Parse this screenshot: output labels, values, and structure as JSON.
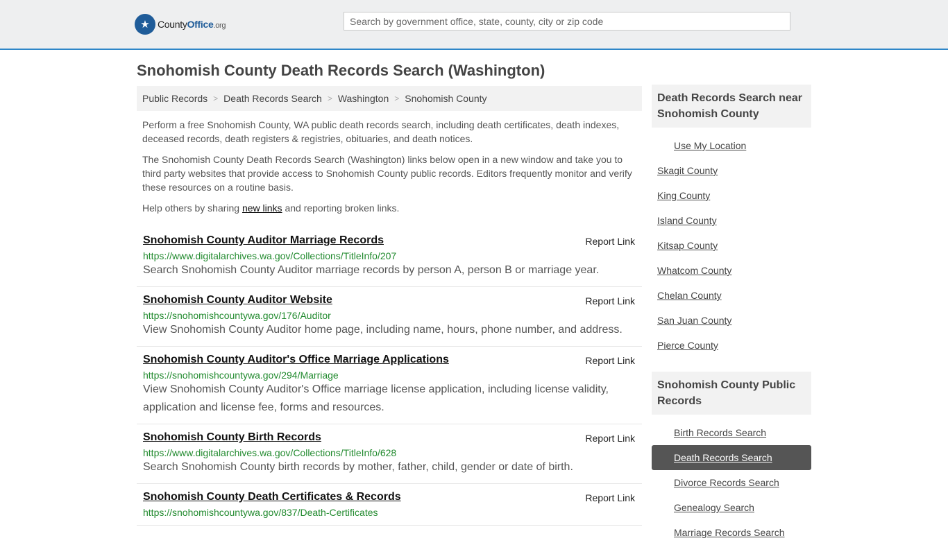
{
  "header": {
    "logo_county": "County",
    "logo_office": "Office",
    "logo_org": ".org",
    "search_placeholder": "Search by government office, state, county, city or zip code"
  },
  "page_title": "Snohomish County Death Records Search (Washington)",
  "breadcrumb": [
    "Public Records",
    "Death Records Search",
    "Washington",
    "Snohomish County"
  ],
  "intro": {
    "p1": "Perform a free Snohomish County, WA public death records search, including death certificates, death indexes, deceased records, death registers & registries, obituaries, and death notices.",
    "p2": "The Snohomish County Death Records Search (Washington) links below open in a new window and take you to third party websites that provide access to Snohomish County public records. Editors frequently monitor and verify these resources on a routine basis.",
    "p3_before": "Help others by sharing ",
    "p3_link": "new links",
    "p3_after": " and reporting broken links."
  },
  "report_label": "Report Link",
  "results": [
    {
      "title": "Snohomish County Auditor Marriage Records",
      "url": "https://www.digitalarchives.wa.gov/Collections/TitleInfo/207",
      "desc": "Search Snohomish County Auditor marriage records by person A, person B or marriage year."
    },
    {
      "title": "Snohomish County Auditor Website",
      "url": "https://snohomishcountywa.gov/176/Auditor",
      "desc": "View Snohomish County Auditor home page, including name, hours, phone number, and address."
    },
    {
      "title": "Snohomish County Auditor's Office Marriage Applications",
      "url": "https://snohomishcountywa.gov/294/Marriage",
      "desc": "View Snohomish County Auditor's Office marriage license application, including license validity, application and license fee, forms and resources."
    },
    {
      "title": "Snohomish County Birth Records",
      "url": "https://www.digitalarchives.wa.gov/Collections/TitleInfo/628",
      "desc": "Search Snohomish County birth records by mother, father, child, gender or date of birth."
    },
    {
      "title": "Snohomish County Death Certificates & Records",
      "url": "https://snohomishcountywa.gov/837/Death-Certificates",
      "desc": ""
    }
  ],
  "sidebar": {
    "near_title": "Death Records Search near Snohomish County",
    "use_location": "Use My Location",
    "near": [
      "Skagit County",
      "King County",
      "Island County",
      "Kitsap County",
      "Whatcom County",
      "Chelan County",
      "San Juan County",
      "Pierce County"
    ],
    "public_title": "Snohomish County Public Records",
    "public": [
      "Birth Records Search",
      "Death Records Search",
      "Divorce Records Search",
      "Genealogy Search",
      "Marriage Records Search"
    ],
    "active_index": 1
  }
}
